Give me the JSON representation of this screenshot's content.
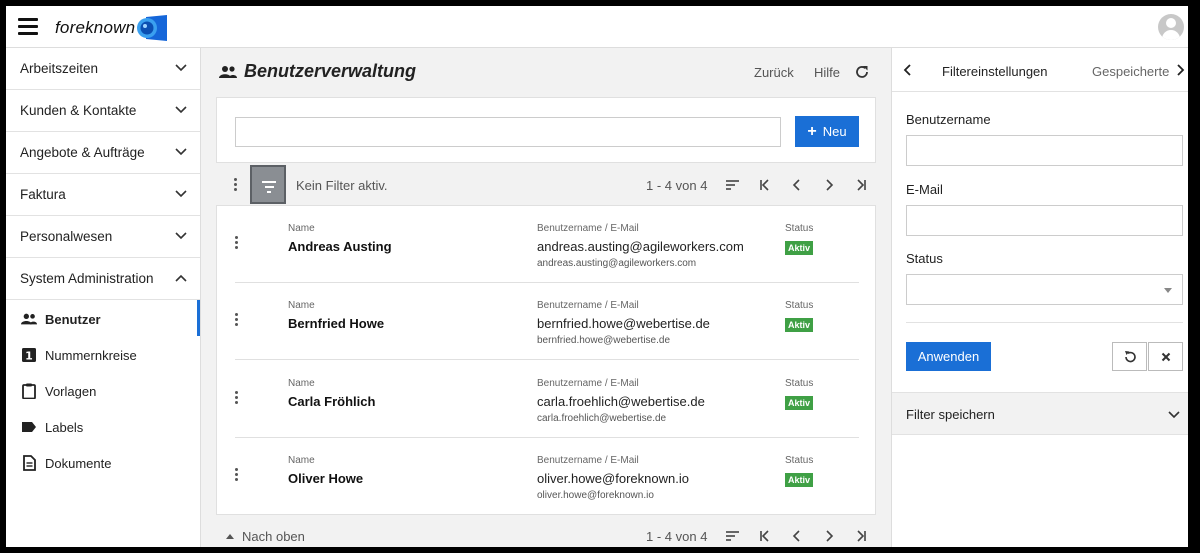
{
  "app": {
    "brand": "foreknown"
  },
  "sidebar": {
    "sections": [
      {
        "label": "Arbeitszeiten"
      },
      {
        "label": "Kunden & Kontakte"
      },
      {
        "label": "Angebote & Aufträge"
      },
      {
        "label": "Faktura"
      },
      {
        "label": "Personalwesen"
      },
      {
        "label": "System Administration"
      }
    ],
    "subitems": [
      {
        "label": "Benutzer",
        "icon": "users-icon",
        "active": true
      },
      {
        "label": "Nummernkreise",
        "icon": "number-one-icon"
      },
      {
        "label": "Vorlagen",
        "icon": "clipboard-icon"
      },
      {
        "label": "Labels",
        "icon": "label-tag-icon"
      },
      {
        "label": "Dokumente",
        "icon": "document-icon"
      }
    ]
  },
  "page": {
    "title": "Benutzerverwaltung",
    "back_label": "Zurück",
    "help_label": "Hilfe"
  },
  "search": {
    "value": "",
    "new_label": "Neu"
  },
  "toolbar": {
    "filter_status": "Kein Filter aktiv.",
    "pagination": "1 - 4 von 4"
  },
  "columns": {
    "name": "Name",
    "user": "Benutzername / E-Mail",
    "status": "Status"
  },
  "users": [
    {
      "name": "Andreas Austing",
      "username": "andreas.austing@agileworkers.com",
      "email": "andreas.austing@agileworkers.com",
      "status": "Aktiv"
    },
    {
      "name": "Bernfried Howe",
      "username": "bernfried.howe@webertise.de",
      "email": "bernfried.howe@webertise.de",
      "status": "Aktiv"
    },
    {
      "name": "Carla Fröhlich",
      "username": "carla.froehlich@webertise.de",
      "email": "carla.froehlich@webertise.de",
      "status": "Aktiv"
    },
    {
      "name": "Oliver Howe",
      "username": "oliver.howe@foreknown.io",
      "email": "oliver.howe@foreknown.io",
      "status": "Aktiv"
    }
  ],
  "bottom": {
    "back_to_top": "Nach oben",
    "pagination": "1 - 4 von 4"
  },
  "filter_panel": {
    "tab_active": "Filtereinstellungen",
    "tab_other": "Gespeicherte",
    "username_label": "Benutzername",
    "username_value": "",
    "email_label": "E-Mail",
    "email_value": "",
    "status_label": "Status",
    "status_value": "",
    "apply_label": "Anwenden",
    "save_filter_label": "Filter speichern"
  },
  "colors": {
    "accent": "#1a6fd6",
    "status_active": "#3fa045"
  }
}
